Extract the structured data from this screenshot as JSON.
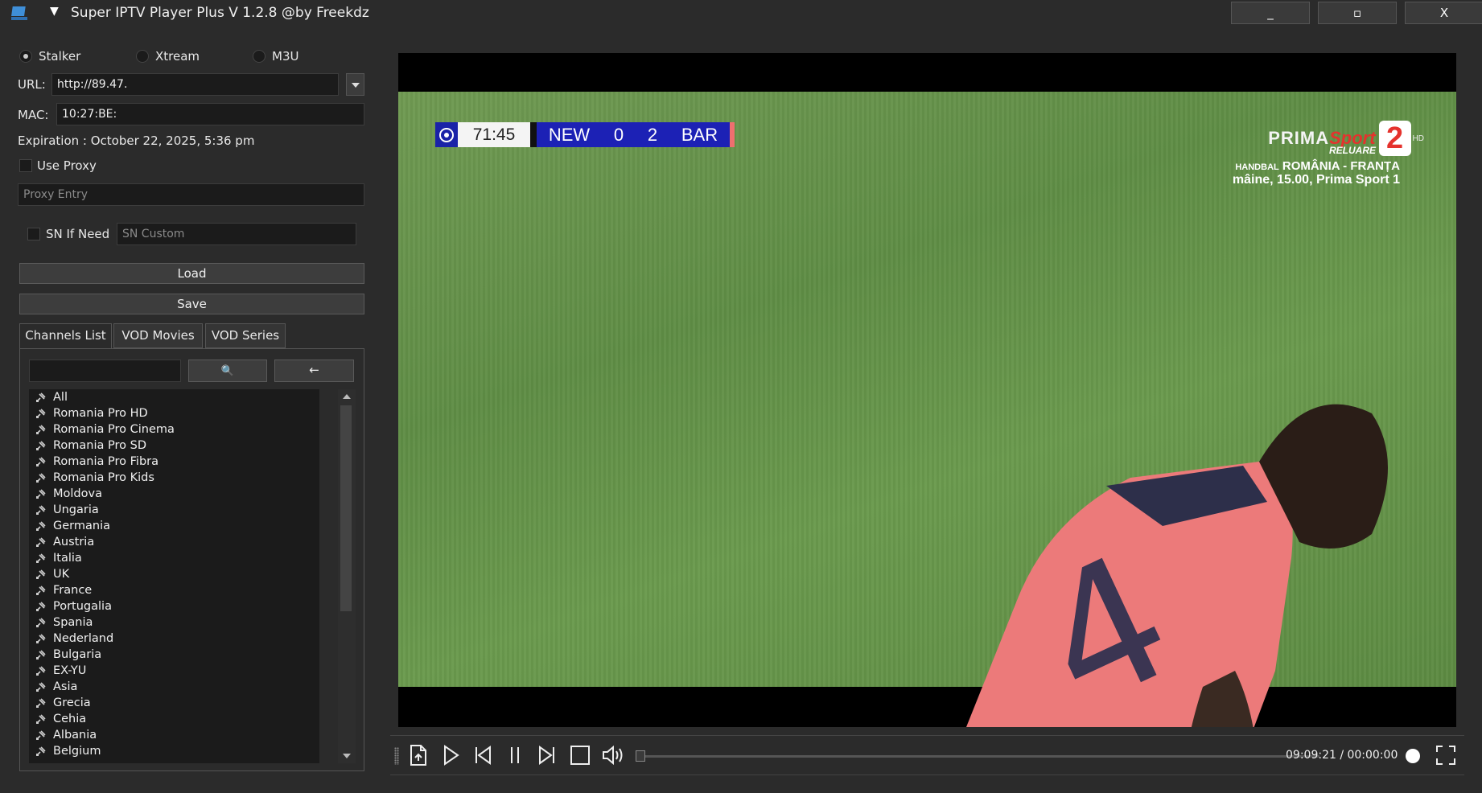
{
  "window": {
    "title": "Super IPTV Player Plus V 1.2.8 @by Freekdz",
    "minimize_label": "_",
    "maximize_label": "▫",
    "close_label": "X",
    "menu_caret": "▼"
  },
  "source": {
    "options": [
      "Stalker",
      "Xtream",
      "M3U"
    ],
    "selected": "Stalker"
  },
  "url": {
    "label": "URL:",
    "value": "http://89.47."
  },
  "mac": {
    "label": "MAC:",
    "value": "10:27:BE:"
  },
  "expiration": "Expiration : October 22, 2025, 5:36 pm",
  "proxy": {
    "checkbox_label": "Use Proxy",
    "checked": false,
    "placeholder": "Proxy Entry"
  },
  "sn": {
    "checkbox_label": "SN If Need",
    "checked": false,
    "placeholder": "SN Custom"
  },
  "buttons": {
    "load": "Load",
    "save": "Save"
  },
  "tabs": [
    "Channels List",
    "VOD Movies",
    "VOD Series"
  ],
  "active_tab": "Channels List",
  "search": {
    "value": "",
    "search_button": "🔍",
    "back_button": "←"
  },
  "channels": [
    "All",
    "Romania Pro HD",
    "Romania Pro Cinema",
    "Romania Pro SD",
    "Romania Pro Fibra",
    "Romania Pro Kids",
    "Moldova",
    "Ungaria",
    "Germania",
    "Austria",
    "Italia",
    "UK",
    "France",
    "Portugalia",
    "Spania",
    "Nederland",
    "Bulgaria",
    "EX-YU",
    "Asia",
    "Grecia",
    "Cehia",
    "Albania",
    "Belgium"
  ],
  "video": {
    "scorebug": {
      "clock": "71:45",
      "home": "NEW",
      "home_score": "0",
      "away_score": "2",
      "away": "BAR"
    },
    "channel": {
      "prima": "PRIMA",
      "sport": "Sport",
      "number": "2",
      "hd": "HD",
      "reluare": "RELUARE",
      "promo_line1_prefix": "HANDBAL",
      "promo_line1": "ROMÂNIA - FRANȚA",
      "promo_line2": "mâine, 15.00, Prima Sport 1"
    },
    "player_number": "4"
  },
  "player_controls": {
    "time": "09:09:21 / 00:00:00",
    "progress": 0.0,
    "colors": {
      "accent": "#ffffff",
      "panel": "#2b2b2b"
    }
  }
}
